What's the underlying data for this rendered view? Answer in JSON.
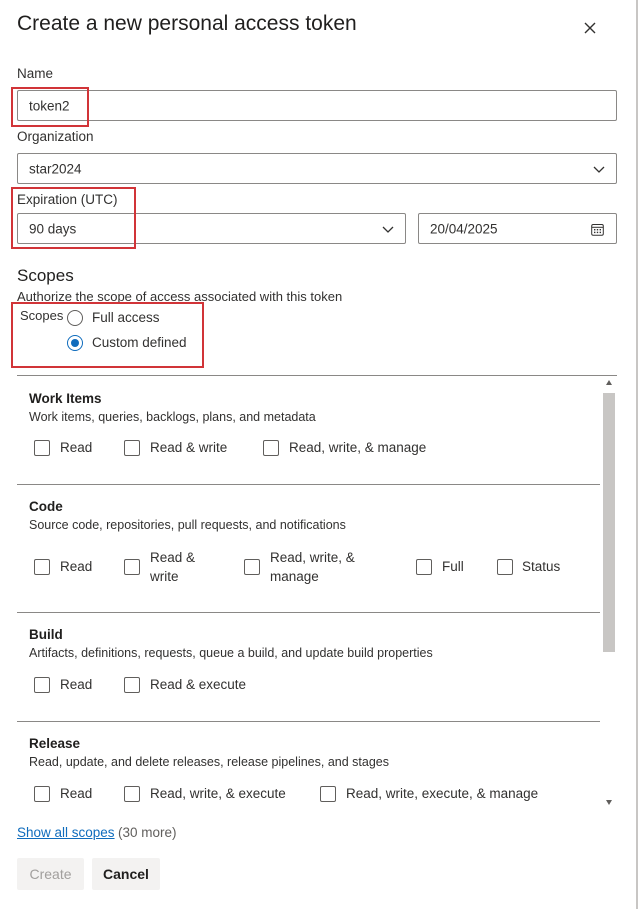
{
  "dialog": {
    "title": "Create a new personal access token",
    "close_icon": "close-icon"
  },
  "name": {
    "label": "Name",
    "value": "token2"
  },
  "organization": {
    "label": "Organization",
    "value": "star2024"
  },
  "expiration": {
    "label": "Expiration (UTC)",
    "value": "90 days",
    "date": "20/04/2025",
    "calendar_icon": "calendar-icon"
  },
  "scopes": {
    "heading": "Scopes",
    "description": "Authorize the scope of access associated with this token",
    "radio_label": "Scopes",
    "options": [
      {
        "label": "Full access",
        "selected": false
      },
      {
        "label": "Custom defined",
        "selected": true
      }
    ]
  },
  "sections": [
    {
      "title": "Work Items",
      "description": "Work items, queries, backlogs, plans, and metadata",
      "options": [
        "Read",
        "Read & write",
        "Read, write, & manage"
      ]
    },
    {
      "title": "Code",
      "description": "Source code, repositories, pull requests, and notifications",
      "options": [
        "Read",
        "Read & write",
        "Read, write, & manage",
        "Full",
        "Status"
      ]
    },
    {
      "title": "Build",
      "description": "Artifacts, definitions, requests, queue a build, and update build properties",
      "options": [
        "Read",
        "Read & execute"
      ]
    },
    {
      "title": "Release",
      "description": "Read, update, and delete releases, release pipelines, and stages",
      "options": [
        "Read",
        "Read, write, & execute",
        "Read, write, execute, & manage"
      ]
    }
  ],
  "footer": {
    "show_all": "Show all scopes",
    "more": "(30 more)",
    "create": "Create",
    "cancel": "Cancel"
  },
  "colors": {
    "accent": "#0f6cbd",
    "highlight": "#d13438",
    "disabled_text": "#a19f9d"
  }
}
